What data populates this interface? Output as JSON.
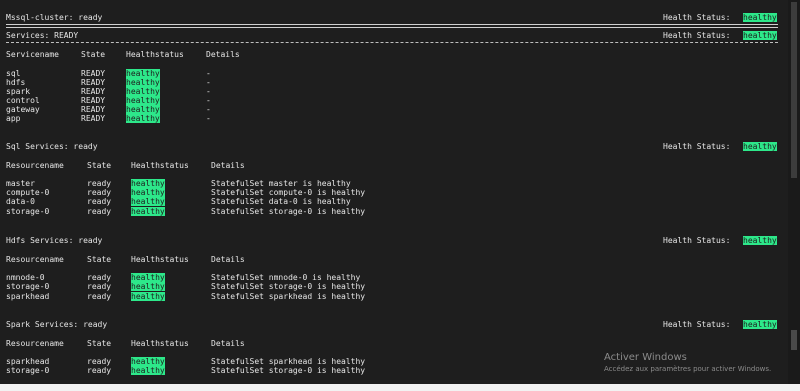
{
  "cluster": {
    "label": "Mssql-cluster: ready"
  },
  "health_label": "Health Status:",
  "health_value": "healthy",
  "services": {
    "title": "Services: READY",
    "headers": [
      "Servicename",
      "State",
      "Healthstatus",
      "Details"
    ],
    "rows": [
      [
        "sql",
        "READY",
        "healthy",
        "-"
      ],
      [
        "hdfs",
        "READY",
        "healthy",
        "-"
      ],
      [
        "spark",
        "READY",
        "healthy",
        "-"
      ],
      [
        "control",
        "READY",
        "healthy",
        "-"
      ],
      [
        "gateway",
        "READY",
        "healthy",
        "-"
      ],
      [
        "app",
        "READY",
        "healthy",
        "-"
      ]
    ]
  },
  "sections": [
    {
      "title": "Sql Services: ready",
      "headers": [
        "Resourcename",
        "State",
        "Healthstatus",
        "Details"
      ],
      "rows": [
        [
          "master",
          "ready",
          "healthy",
          "StatefulSet master is healthy"
        ],
        [
          "compute-0",
          "ready",
          "healthy",
          "StatefulSet compute-0 is healthy"
        ],
        [
          "data-0",
          "ready",
          "healthy",
          "StatefulSet data-0 is healthy"
        ],
        [
          "storage-0",
          "ready",
          "healthy",
          "StatefulSet storage-0 is healthy"
        ]
      ]
    },
    {
      "title": "Hdfs Services: ready",
      "headers": [
        "Resourcename",
        "State",
        "Healthstatus",
        "Details"
      ],
      "rows": [
        [
          "nmnode-0",
          "ready",
          "healthy",
          "StatefulSet nmnode-0 is healthy"
        ],
        [
          "storage-0",
          "ready",
          "healthy",
          "StatefulSet storage-0 is healthy"
        ],
        [
          "sparkhead",
          "ready",
          "healthy",
          "StatefulSet sparkhead is healthy"
        ]
      ]
    },
    {
      "title": "Spark Services: ready",
      "headers": [
        "Resourcename",
        "State",
        "Healthstatus",
        "Details"
      ],
      "rows": [
        [
          "sparkhead",
          "ready",
          "healthy",
          "StatefulSet sparkhead is healthy"
        ],
        [
          "storage-0",
          "ready",
          "healthy",
          "StatefulSet storage-0 is healthy"
        ]
      ]
    }
  ],
  "watermark": {
    "title": "Activer Windows",
    "subtitle": "Accédez aux paramètres pour activer Windows."
  },
  "statusbar": {
    "text": ""
  },
  "colors": {
    "background": "#1e1e1e",
    "healthy": "#2de88a",
    "text": "#e6e6e6"
  }
}
